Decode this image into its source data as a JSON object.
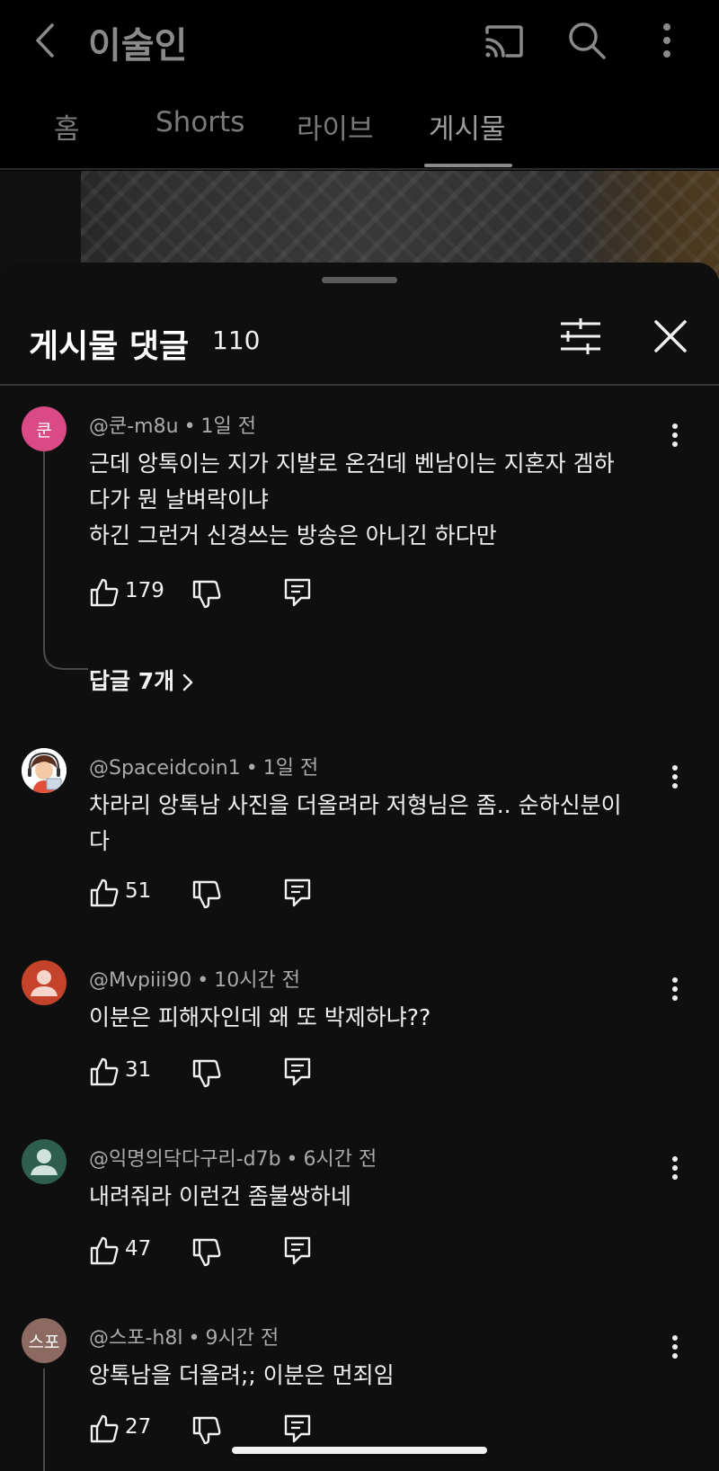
{
  "header": {
    "channel_title": "이술인",
    "tabs": [
      {
        "label": "홈"
      },
      {
        "label": "Shorts"
      },
      {
        "label": "라이브"
      },
      {
        "label": "게시물"
      }
    ],
    "active_tab": "게시물"
  },
  "sheet": {
    "title": "게시물 댓글",
    "count": "110"
  },
  "comments": [
    {
      "avatar_text": "쿤",
      "avatar_color": "#d94a86",
      "author": "@쿤-m8u",
      "time": "1일 전",
      "lines": [
        "근데 앙톡이는 지가 지발로 온건데 벤남이는 지혼자 겜하",
        "다가 뭔 날벼락이냐",
        "하긴 그런거 신경쓰는 방송은 아니긴 하다만"
      ],
      "likes": "179",
      "replies_label": "답글 7개"
    },
    {
      "avatar_text": "",
      "avatar_color": "#ffffff",
      "author": "@Spaceidcoin1",
      "time": "1일 전",
      "lines": [
        "차라리 앙톡남 사진을 더올려라 저형님은 좀.. 순하신분이",
        "다"
      ],
      "likes": "51"
    },
    {
      "avatar_text": "",
      "avatar_color": "#c4432a",
      "author": "@Mvpiii90",
      "time": "10시간 전",
      "lines": [
        "이분은 피해자인데 왜 또 박제하냐??"
      ],
      "likes": "31"
    },
    {
      "avatar_text": "",
      "avatar_color": "#2e5e4e",
      "author": "@익명의닥다구리-d7b",
      "time": "6시간 전",
      "lines": [
        "내려줘라 이런건 좀불쌍하네"
      ],
      "likes": "47"
    },
    {
      "avatar_text": "스포",
      "avatar_color": "#8c6a62",
      "author": "@스포-h8l",
      "time": "9시간 전",
      "lines": [
        "앙톡남을 더올려;; 이분은 먼죄임"
      ],
      "likes": "27"
    }
  ],
  "icons": {
    "back": "chevron-left-icon",
    "cast": "cast-icon",
    "search": "search-icon",
    "more": "more-vert-icon",
    "filter": "sliders-icon",
    "close": "close-icon",
    "like": "thumb-up-icon",
    "dislike": "thumb-down-icon",
    "reply": "comment-icon"
  }
}
